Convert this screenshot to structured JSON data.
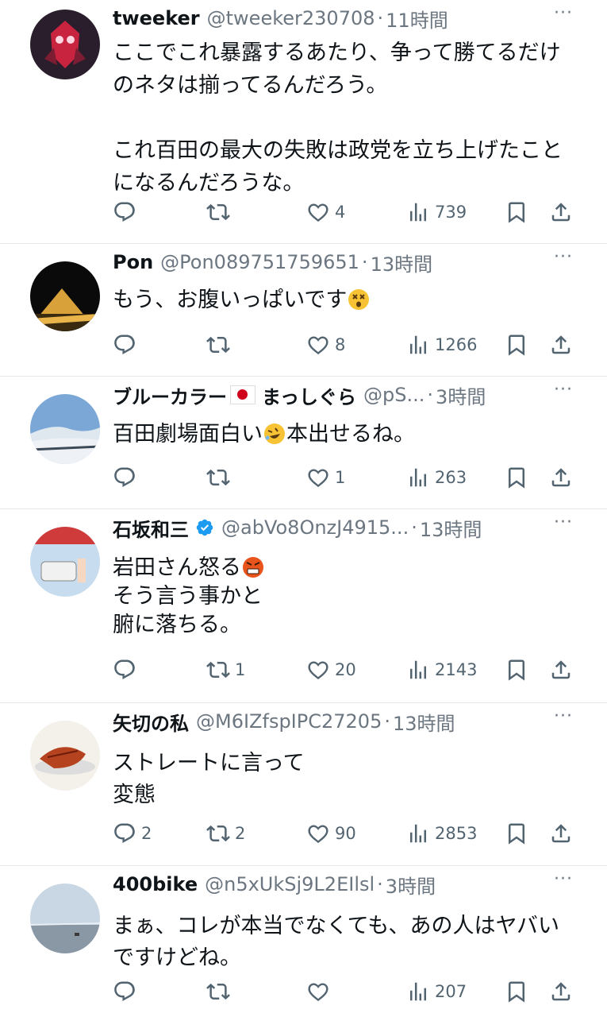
{
  "tweets": [
    {
      "name": "tweeker",
      "handle": "@tweeker230708",
      "sep": "·",
      "time": "11時間",
      "lines": [
        "ここでこれ暴露するあたり、争って勝てるだけ",
        "のネタは揃ってるんだろう。",
        "",
        "これ百田の最大の失敗は政党を立ち上げたこと",
        "になるんだろうな。"
      ],
      "replies": "",
      "retweets": "",
      "likes": "4",
      "views": "739",
      "avatar_colors": [
        "#2a1e2c",
        "#c9243f"
      ]
    },
    {
      "name": "Pon",
      "handle": "@Pon089751759651",
      "sep": "·",
      "time": "13時間",
      "lines": [
        "もう、お腹いっぱいです"
      ],
      "emoji_after_line": 0,
      "emoji": "dizzy-face",
      "replies": "",
      "retweets": "",
      "likes": "8",
      "views": "1266",
      "avatar_colors": [
        "#0a0a0a",
        "#d9a13a"
      ]
    },
    {
      "name": "ブルーカラー",
      "name2": "まっしぐら",
      "handle": "@pS...",
      "sep": "·",
      "time": "3時間",
      "line_parts": [
        "百田劇場面白い",
        "本出せるね。"
      ],
      "emoji": "rolling-laughing",
      "replies": "",
      "retweets": "",
      "likes": "1",
      "views": "263",
      "avatar_colors": [
        "#7aa7d6",
        "#eef2f6"
      ]
    },
    {
      "name": "石坂和三",
      "handle": "@abVo8OnzJ4915...",
      "sep": "·",
      "time": "13時間",
      "lines": [
        "岩田さん怒る",
        "そう言う事かと",
        "腑に落ちる。"
      ],
      "emoji": "angry-face",
      "replies": "",
      "retweets": "1",
      "likes": "20",
      "views": "2143",
      "avatar_colors": [
        "#c7dcee",
        "#cf3b3b"
      ]
    },
    {
      "name": "矢切の私",
      "handle": "@M6IZfspIPC27205",
      "sep": "·",
      "time": "13時間",
      "lines": [
        "ストレートに言って",
        "変態"
      ],
      "replies": "2",
      "retweets": "2",
      "likes": "90",
      "views": "2853",
      "avatar_colors": [
        "#f4f0ea",
        "#b5431f"
      ]
    },
    {
      "name": "400bike",
      "handle": "@n5xUkSj9L2EIlsl",
      "sep": "·",
      "time": "3時間",
      "lines": [
        "まぁ、コレが本当でなくても、あの人はヤバい",
        "ですけどね。"
      ],
      "replies": "",
      "retweets": "",
      "likes": "",
      "views": "207",
      "avatar_colors": [
        "#c9d6e3",
        "#8a98a6"
      ]
    }
  ],
  "icons": {
    "reply": "reply-icon",
    "retweet": "retweet-icon",
    "like": "like-icon",
    "views": "views-icon",
    "bookmark": "bookmark-icon",
    "share": "share-icon",
    "more": "more-icon"
  },
  "colors": {
    "text": "#0f1419",
    "secondary": "#536471",
    "verified": "#1d9bf0",
    "divider": "#e6e6e6"
  }
}
